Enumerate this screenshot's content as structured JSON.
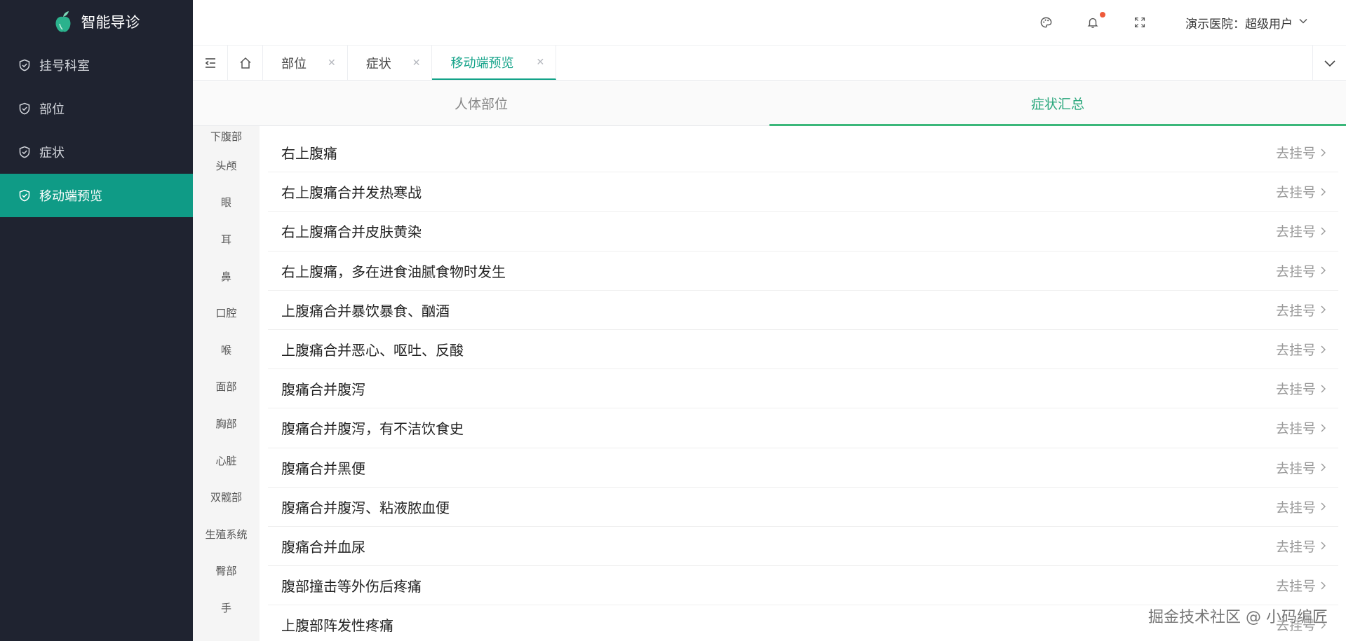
{
  "brand": {
    "name": "智能导诊"
  },
  "sidebar": {
    "items": [
      {
        "label": "挂号科室"
      },
      {
        "label": "部位"
      },
      {
        "label": "症状"
      },
      {
        "label": "移动端预览"
      }
    ]
  },
  "header": {
    "user_label": "演示医院：超级用户"
  },
  "tabs": [
    {
      "label": "部位"
    },
    {
      "label": "症状"
    },
    {
      "label": "移动端预览"
    }
  ],
  "segment": {
    "left": "人体部位",
    "right": "症状汇总"
  },
  "categories": [
    "下腹部",
    "头颅",
    "眼",
    "耳",
    "鼻",
    "口腔",
    "喉",
    "面部",
    "胸部",
    "心脏",
    "双髋部",
    "生殖系统",
    "臀部",
    "手"
  ],
  "symptoms": [
    "右上腹痛",
    "右上腹痛合并发热寒战",
    "右上腹痛合并皮肤黄染",
    "右上腹痛，多在进食油腻食物时发生",
    "上腹痛合并暴饮暴食、酗酒",
    "上腹痛合并恶心、呕吐、反酸",
    "腹痛合并腹泻",
    "腹痛合并腹泻，有不洁饮食史",
    "腹痛合并黑便",
    "腹痛合并腹泻、粘液脓血便",
    "腹痛合并血尿",
    "腹部撞击等外伤后疼痛",
    "上腹部阵发性疼痛"
  ],
  "go_label": "去挂号",
  "watermark": "掘金技术社区 @ 小码编匠",
  "colors": {
    "accent": "#14a389",
    "sidebar_bg": "#1f2330",
    "badge": "#ee5a3a"
  }
}
